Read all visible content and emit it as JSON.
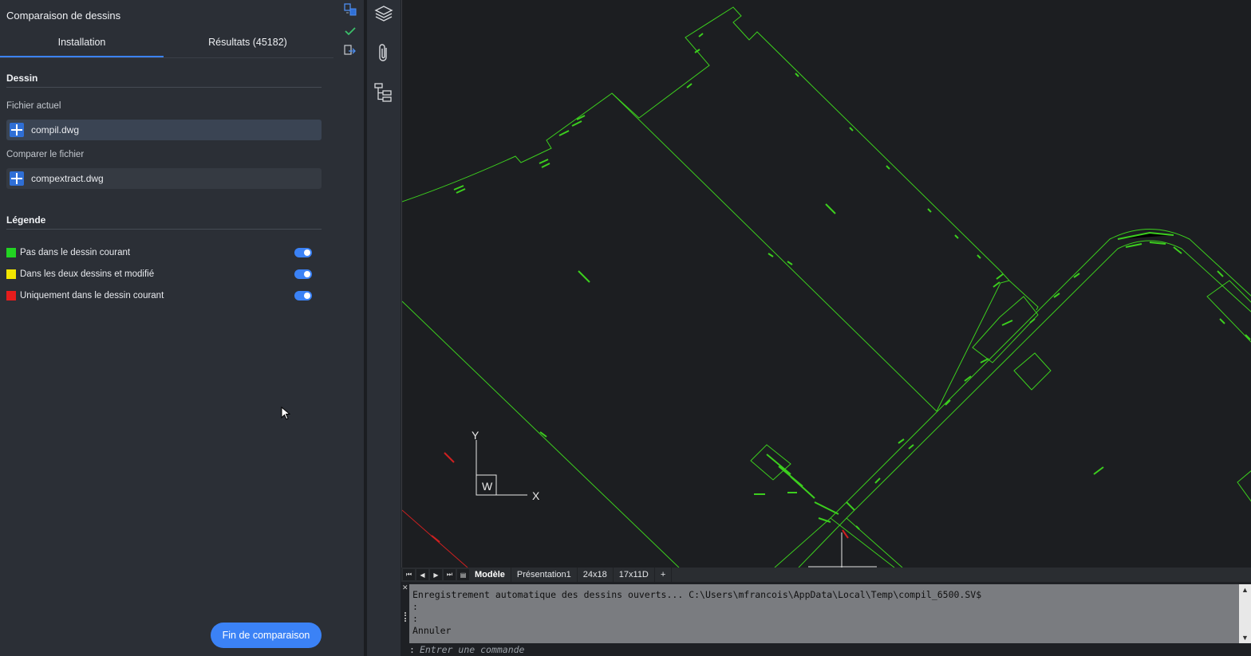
{
  "panel": {
    "title": "Comparaison de dessins",
    "tabs": [
      {
        "label": "Installation",
        "active": true
      },
      {
        "label": "Résultats (45182)",
        "active": false
      }
    ],
    "drawing_section": {
      "heading": "Dessin",
      "current_file_label": "Fichier actuel",
      "current_file": "compil.dwg",
      "compare_file_label": "Comparer le fichier",
      "compare_file": "compextract.dwg"
    },
    "legend_section": {
      "heading": "Légende",
      "items": [
        {
          "label": "Pas dans le dessin courant",
          "color": "#22d422",
          "enabled": true
        },
        {
          "label": "Dans les deux dessins et modifié",
          "color": "#f2e600",
          "enabled": true
        },
        {
          "label": "Uniquement dans le dessin courant",
          "color": "#e61c1c",
          "enabled": true
        }
      ]
    },
    "end_button": "Fin de comparaison",
    "side_icons": [
      "swap-files-icon",
      "checkmark-icon",
      "export-icon"
    ]
  },
  "toolbar": {
    "icons": [
      "layers-icon",
      "attachment-icon",
      "structure-tree-icon"
    ]
  },
  "canvas": {
    "background": "#1c1e21",
    "line_color": "#3ccf1e",
    "ucs": {
      "y_label": "Y",
      "x_label": "X",
      "w_label": "W"
    }
  },
  "layout_tabs": {
    "tabs": [
      {
        "label": "Modèle",
        "active": true
      },
      {
        "label": "Présentation1",
        "active": false
      },
      {
        "label": "24x18",
        "active": false
      },
      {
        "label": "17x11D",
        "active": false
      }
    ],
    "add_label": "+"
  },
  "command_line": {
    "history": [
      "Enregistrement automatique des dessins ouverts... C:\\Users\\mfrancois\\AppData\\Local\\Temp\\compil_6500.SV$",
      ":",
      ":",
      "Annuler"
    ],
    "prompt": ":",
    "placeholder": "Entrer une commande"
  }
}
